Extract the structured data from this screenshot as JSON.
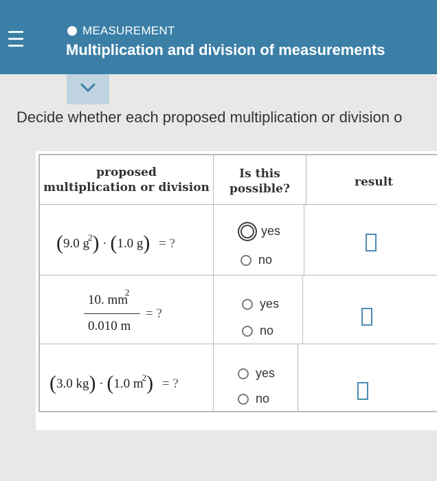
{
  "header": {
    "topic": "MEASUREMENT",
    "title": "Multiplication and division of measurements"
  },
  "instruction": "Decide whether each proposed multiplication or division o",
  "table": {
    "columns": [
      "proposed multiplication or division",
      "Is this possible?",
      "result"
    ],
    "col_header_1a": "proposed",
    "col_header_1b": "multiplication or division",
    "col_header_2a": "Is this",
    "col_header_2b": "possible?",
    "col_header_3": "result",
    "rows": [
      {
        "expr_a": "9.0 g",
        "exp_a": "2",
        "dot": "·",
        "expr_b": "1.0 g",
        "equals": "= ?",
        "yes_label": "yes",
        "no_label": "no",
        "selected": "yes"
      },
      {
        "numerator": "10. mm",
        "num_exp": "2",
        "denominator": "0.010 m",
        "equals": "= ?",
        "yes_label": "yes",
        "no_label": "no",
        "selected": ""
      },
      {
        "expr_a": "3.0 kg",
        "dot": "·",
        "expr_b": "1.0 m",
        "exp_b": "2",
        "equals": "= ?",
        "yes_label": "yes",
        "no_label": "no",
        "selected": ""
      }
    ]
  },
  "colors": {
    "header_bg": "#3b7fa6",
    "tab_bg": "#bfd4e0",
    "result_box_border": "#4a8bb3"
  },
  "icons": {
    "menu": "hamburger-icon",
    "topic_dot": "circle-dot-icon",
    "expand": "chevron-down-icon"
  }
}
